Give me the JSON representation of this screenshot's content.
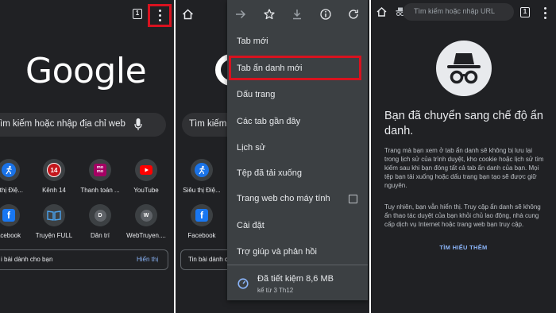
{
  "panel1": {
    "tab_count": "1",
    "logo": "Google",
    "search_placeholder": "ìm kiếm hoặc nhập địa chỉ web",
    "shortcuts_row1": [
      {
        "label": "n thị Điệ...",
        "icon": "running-person-icon",
        "color": "#1a73e8"
      },
      {
        "label": "Kênh 14",
        "icon": "kenh14-logo-icon",
        "color": "#c4161c",
        "glyph": "14"
      },
      {
        "label": "Thanh toán ...",
        "icon": "momo-logo-icon",
        "color": "#a50064",
        "glyph": "mo mo"
      },
      {
        "label": "YouTube",
        "icon": "youtube-logo-icon",
        "color": "#ff0000"
      }
    ],
    "shortcuts_row2": [
      {
        "label": "acebook",
        "icon": "facebook-logo-icon",
        "color": "#1877f2",
        "glyph": "f"
      },
      {
        "label": "Truyện FULL",
        "icon": "book-icon",
        "color": "#4285f4"
      },
      {
        "label": "Dân trí",
        "icon": "letter-avatar-icon",
        "color": "#5f6368",
        "glyph": "D"
      },
      {
        "label": "WebTruyen....",
        "icon": "letter-avatar-icon",
        "color": "#5f6368",
        "glyph": "W"
      }
    ],
    "feed_text": "i bài dành cho bạn",
    "feed_link": "Hiển thị"
  },
  "panel2": {
    "search_placeholder": "Tìm kiếm",
    "shortcuts_row1": [
      {
        "label": "Siêu thị Điệ...",
        "icon": "running-person-icon",
        "color": "#1a73e8"
      }
    ],
    "shortcuts_row2": [
      {
        "label": "Facebook",
        "icon": "facebook-logo-icon",
        "color": "#1877f2",
        "glyph": "f"
      }
    ],
    "feed_text": "Tin bài dành cho",
    "menu": {
      "toolbar_icons": [
        "forward-arrow-icon",
        "star-icon",
        "download-icon",
        "info-icon",
        "reload-icon"
      ],
      "items": [
        {
          "label": "Tab mới"
        },
        {
          "label": "Tab ẩn danh mới"
        },
        {
          "label": "Dấu trang"
        },
        {
          "label": "Các tab gần đây"
        },
        {
          "label": "Lịch sử"
        },
        {
          "label": "Tệp đã tải xuống"
        },
        {
          "label": "Trang web cho máy tính"
        },
        {
          "label": "Cài đặt"
        },
        {
          "label": "Trợ giúp và phản hồi"
        }
      ],
      "saved_title": "Đã tiết kiệm 8,6 MB",
      "saved_sub": "kể từ 3 Th12"
    }
  },
  "panel3": {
    "tab_count": "1",
    "omnibox_placeholder": "Tìm kiếm hoặc nhập URL",
    "title": "Bạn đã chuyển sang chế độ ẩn danh.",
    "para1": "Trang mà bạn xem ở tab ẩn danh sẽ không bị lưu lại trong lịch sử của trình duyệt, kho cookie hoặc lịch sử tìm kiếm sau khi bạn đóng tất cả tab ẩn danh của bạn. Mọi tệp bạn tải xuống hoặc dấu trang bạn tạo sẽ được giữ nguyên.",
    "para2": "Tuy nhiên, bạn vẫn hiển thị. Truy cập ẩn danh sẽ không ẩn thao tác duyệt của bạn khỏi chủ lao động, nhà cung cấp dịch vụ Internet hoặc trang web bạn truy cập.",
    "learn_more": "TÌM HIỂU THÊM"
  },
  "colors": {
    "background": "#202124",
    "menu_background": "#3c4043",
    "highlight_red": "#d8121f",
    "link_blue": "#8ab4f8",
    "text": "#e8eaed"
  }
}
